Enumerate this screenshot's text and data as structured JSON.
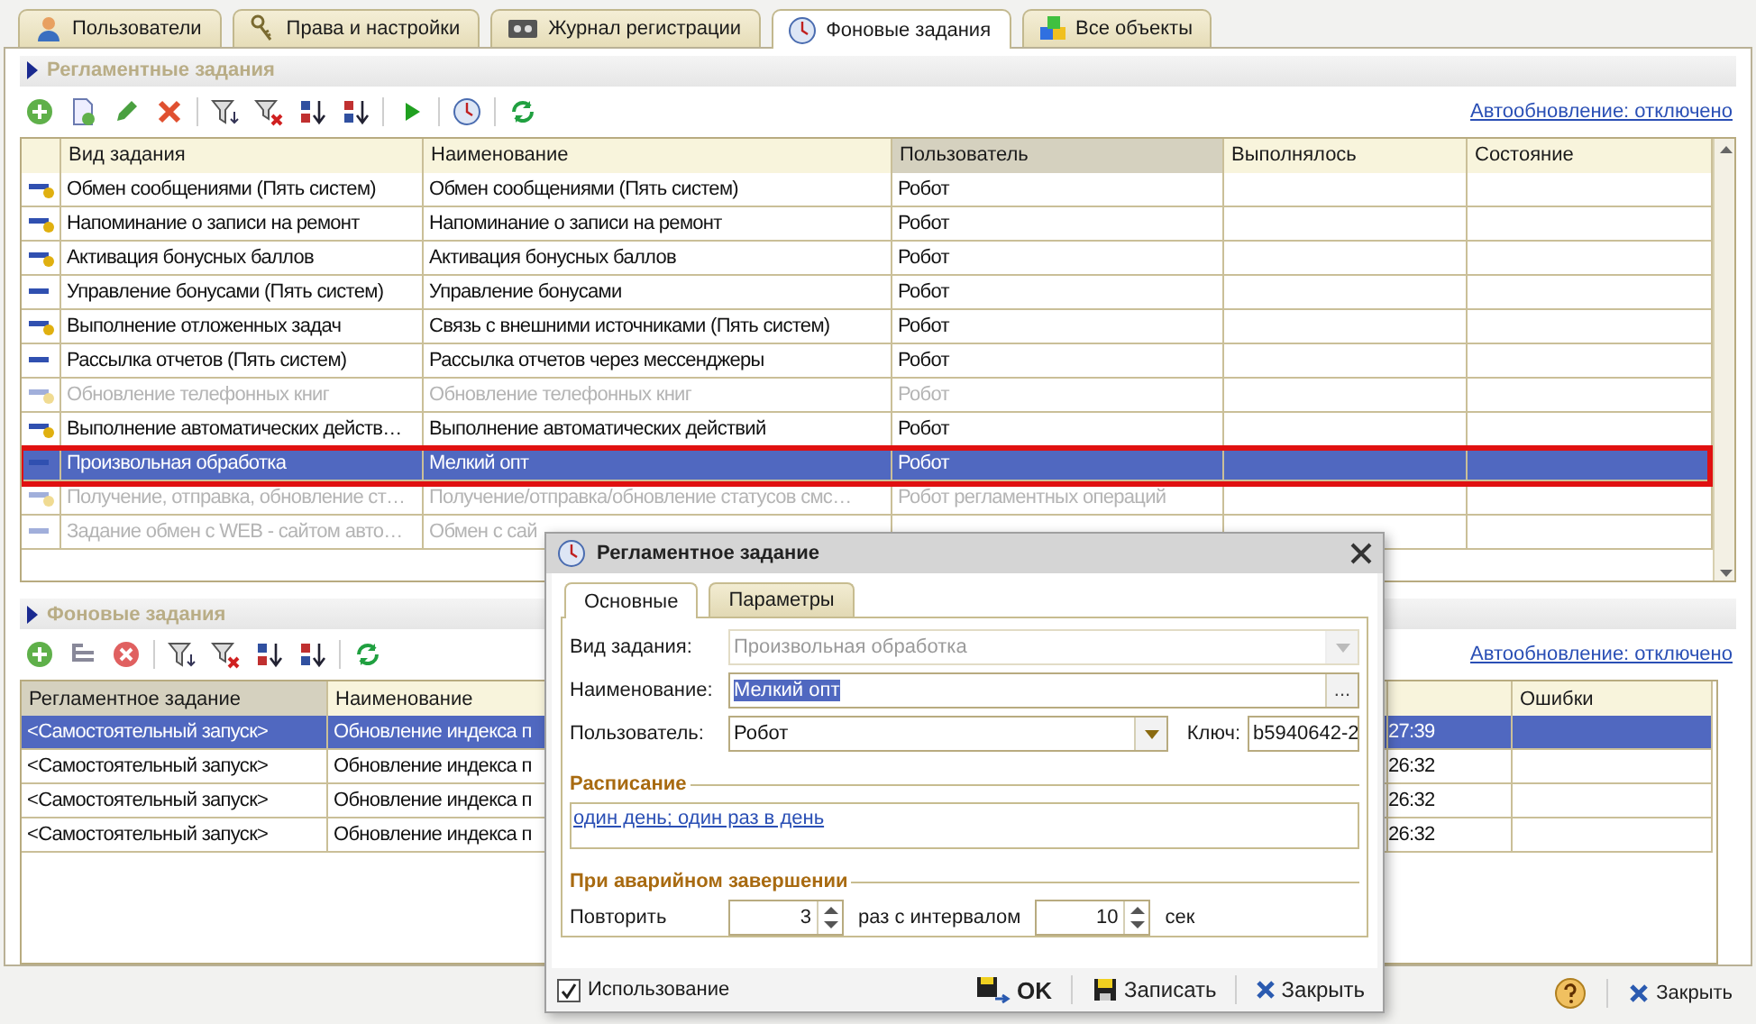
{
  "tabs": [
    {
      "label": "Пользователи",
      "selected": false
    },
    {
      "label": "Права и настройки",
      "selected": false
    },
    {
      "label": "Журнал регистрации",
      "selected": false
    },
    {
      "label": "Фоновые задания",
      "selected": true
    },
    {
      "label": "Все объекты",
      "selected": false
    }
  ],
  "scheduled": {
    "title": "Регламентные задания",
    "autoupdate": "Автообновление: отключено",
    "columns": [
      {
        "label": "Вид задания",
        "sorted": false
      },
      {
        "label": "Наименование",
        "sorted": false
      },
      {
        "label": "Пользователь",
        "sorted": true
      },
      {
        "label": "Выполнялось",
        "sorted": false
      },
      {
        "label": "Состояние",
        "sorted": false
      }
    ],
    "rows": [
      {
        "kind": "marked",
        "task": "Обмен сообщениями (Пять систем)",
        "name": "Обмен сообщениями (Пять систем)",
        "user": "Робот",
        "disabled": false,
        "selected": false
      },
      {
        "kind": "marked",
        "task": "Напоминание о записи на ремонт",
        "name": "Напоминание о записи на ремонт",
        "user": "Робот",
        "disabled": false,
        "selected": false
      },
      {
        "kind": "marked",
        "task": "Активация бонусных баллов",
        "name": "Активация бонусных баллов",
        "user": "Робот",
        "disabled": false,
        "selected": false
      },
      {
        "kind": "plain",
        "task": "Управление бонусами (Пять систем)",
        "name": "Управление бонусами",
        "user": "Робот",
        "disabled": false,
        "selected": false
      },
      {
        "kind": "marked",
        "task": "Выполнение отложенных задач",
        "name": "Связь с внешними источниками (Пять систем)",
        "user": "Робот",
        "disabled": false,
        "selected": false
      },
      {
        "kind": "plain",
        "task": "Рассылка отчетов (Пять систем)",
        "name": "Рассылка отчетов через мессенджеры",
        "user": "Робот",
        "disabled": false,
        "selected": false
      },
      {
        "kind": "marked",
        "task": "Обновление телефонных книг",
        "name": "Обновление телефонных книг",
        "user": "Робот",
        "disabled": true,
        "selected": false
      },
      {
        "kind": "marked",
        "task": "Выполнение автоматических действ…",
        "name": "Выполнение автоматических действий",
        "user": "Робот",
        "disabled": false,
        "selected": false
      },
      {
        "kind": "plain",
        "task": "Произвольная обработка",
        "name": "Мелкий опт",
        "user": "Робот",
        "disabled": false,
        "selected": true
      },
      {
        "kind": "marked",
        "task": "Получение, отправка, обновление ст…",
        "name": "Получение/отправка/обновление статусов смс…",
        "user": "Робот регламентных операций",
        "disabled": true,
        "selected": false
      },
      {
        "kind": "plain",
        "task": "Задание обмен с WEB - сайтом авто…",
        "name": "Обмен с сай",
        "disabled": true,
        "selected": false
      }
    ]
  },
  "background": {
    "title": "Фоновые задания",
    "autoupdate": "Автообновление: отключено",
    "columns": [
      {
        "label": "Регламентное задание",
        "sorted": true
      },
      {
        "label": "Наименование",
        "sorted": false
      },
      {
        "label": "Ошибки",
        "sorted": false
      }
    ],
    "rows": [
      {
        "job": "<Самостоятельный запуск>",
        "name": "Обновление индекса п",
        "time": "27:39",
        "selected": true
      },
      {
        "job": "<Самостоятельный запуск>",
        "name": "Обновление индекса п",
        "time": "26:32",
        "selected": false
      },
      {
        "job": "<Самостоятельный запуск>",
        "name": "Обновление индекса п",
        "time": "26:32",
        "selected": false
      },
      {
        "job": "<Самостоятельный запуск>",
        "name": "Обновление индекса п",
        "time": "26:32",
        "selected": false
      }
    ]
  },
  "dialog": {
    "title": "Регламентное задание",
    "tabs": [
      {
        "label": "Основные",
        "selected": true
      },
      {
        "label": "Параметры",
        "selected": false
      }
    ],
    "task_type": {
      "label": "Вид задания:",
      "value": "Произвольная обработка",
      "disabled": true
    },
    "name": {
      "label": "Наименование:",
      "value": "Мелкий опт",
      "text_selected": true,
      "choice": "..."
    },
    "user": {
      "label": "Пользователь:",
      "value": "Робот"
    },
    "key": {
      "label": "Ключ:",
      "value": "b5940642-2"
    },
    "schedule": {
      "title": "Расписание",
      "link": "один день; один раз в день"
    },
    "failure": {
      "title": "При аварийном завершении",
      "repeat_label": "Повторить",
      "repeat": "3",
      "interval_label": "раз с интервалом",
      "interval": "10",
      "unit": "сек"
    },
    "use": {
      "label": "Использование",
      "checked": true
    },
    "buttons": [
      {
        "kind": "ok",
        "label": "OK"
      },
      {
        "kind": "save",
        "label": "Записать"
      },
      {
        "kind": "close",
        "label": "Закрыть"
      }
    ]
  },
  "footer": {
    "close": "Закрыть"
  }
}
